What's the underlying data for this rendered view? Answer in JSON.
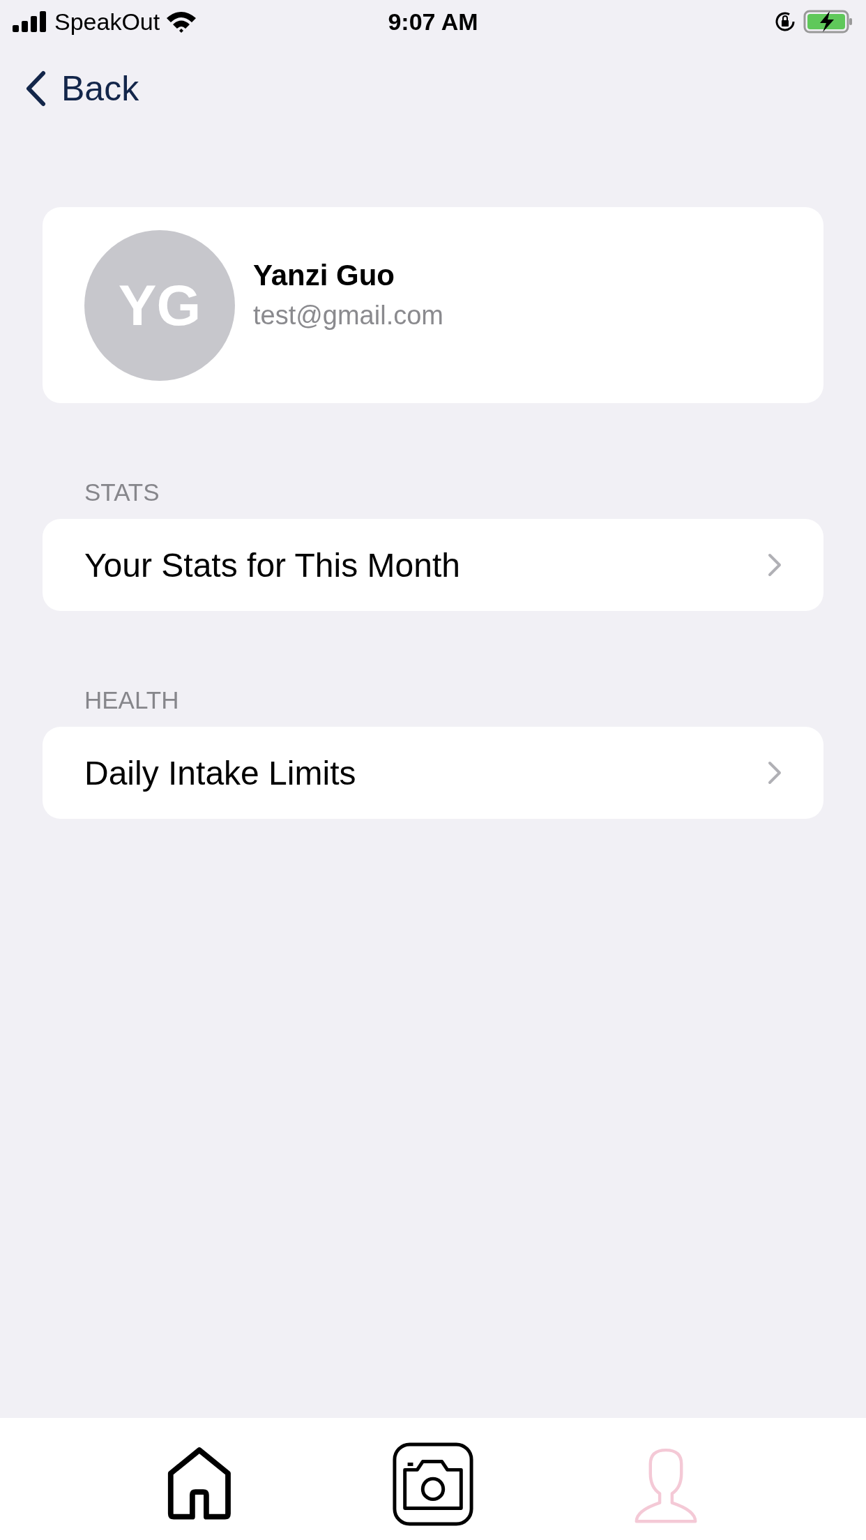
{
  "status_bar": {
    "carrier": "SpeakOut",
    "time": "9:07 AM"
  },
  "nav": {
    "back": "Back"
  },
  "profile": {
    "initials": "YG",
    "name": "Yanzi Guo",
    "email": "test@gmail.com"
  },
  "sections": [
    {
      "header": "STATS",
      "rows": [
        {
          "label": "Your Stats for This Month"
        }
      ]
    },
    {
      "header": "HEALTH",
      "rows": [
        {
          "label": "Daily Intake Limits"
        }
      ]
    }
  ],
  "tab_bar": [
    {
      "kind": "home",
      "selected": false
    },
    {
      "kind": "camera",
      "selected": false
    },
    {
      "kind": "profile",
      "selected": true
    }
  ]
}
